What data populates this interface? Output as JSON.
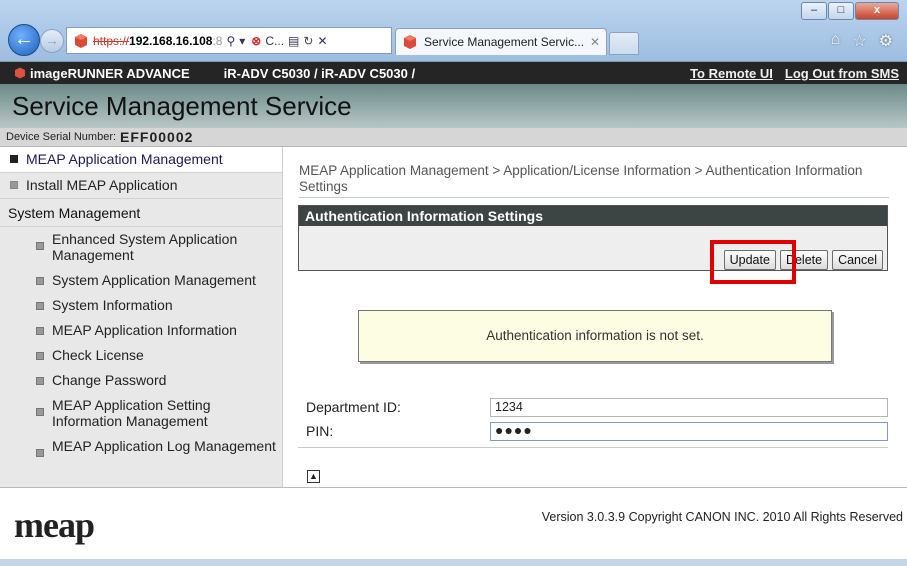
{
  "browser": {
    "window_buttons": [
      "–",
      "□",
      "x"
    ],
    "address": {
      "url_prefix": "https://",
      "url_host": "192.168.16.108",
      "url_tail": ":8",
      "search_glyph": "⚲",
      "dropdown_glyph": "▾",
      "cert_error_label": "C...",
      "lock_glyph": "▤",
      "refresh_glyph": "↻",
      "stop_glyph": "✕"
    },
    "tab": {
      "title": "Service Management Servic...",
      "close": "✕"
    },
    "icons": {
      "home": "⌂",
      "favorites": "☆",
      "tools": "⚙"
    }
  },
  "header": {
    "brand": "imageRUNNER ADVANCE",
    "model": "iR-ADV C5030 / iR-ADV C5030 /",
    "link_remote_ui": "To Remote UI",
    "link_logout": "Log Out from SMS",
    "title": "Service Management Service",
    "serial_label": "Device Serial Number:",
    "serial_value": "EFF00002"
  },
  "sidebar": {
    "items": [
      {
        "label": "MEAP Application Management"
      },
      {
        "label": "Install MEAP Application"
      }
    ],
    "section": "System Management",
    "sub_items": [
      {
        "label": "Enhanced System Application Management"
      },
      {
        "label": "System Application Management"
      },
      {
        "label": "System Information"
      },
      {
        "label": "MEAP Application Information"
      },
      {
        "label": "Check License"
      },
      {
        "label": "Change Password"
      },
      {
        "label": "MEAP Application Setting Information Management"
      },
      {
        "label": "MEAP Application Log Management"
      }
    ]
  },
  "main": {
    "breadcrumb": "MEAP Application Management > Application/License Information > Authentication Information Settings",
    "panel_title": "Authentication Information Settings",
    "buttons": {
      "update": "Update",
      "delete": "Delete",
      "cancel": "Cancel"
    },
    "notice": "Authentication information is not set.",
    "fields": {
      "department_label": "Department ID:",
      "department_value": "1234",
      "pin_label": "PIN:",
      "pin_value": "●●●●"
    },
    "top_icon_glyph": "⏫"
  },
  "footer": {
    "logo": "meap",
    "copyright": "Version 3.0.3.9 Copyright CANON INC. 2010 All Rights Reserved"
  },
  "colors": {
    "topbar_bg": "#252525",
    "title_gradient": "#6b8a88",
    "panel_head_bg": "#3c4444",
    "highlight_border": "#e00000",
    "notice_bg": "#fdfde3"
  }
}
